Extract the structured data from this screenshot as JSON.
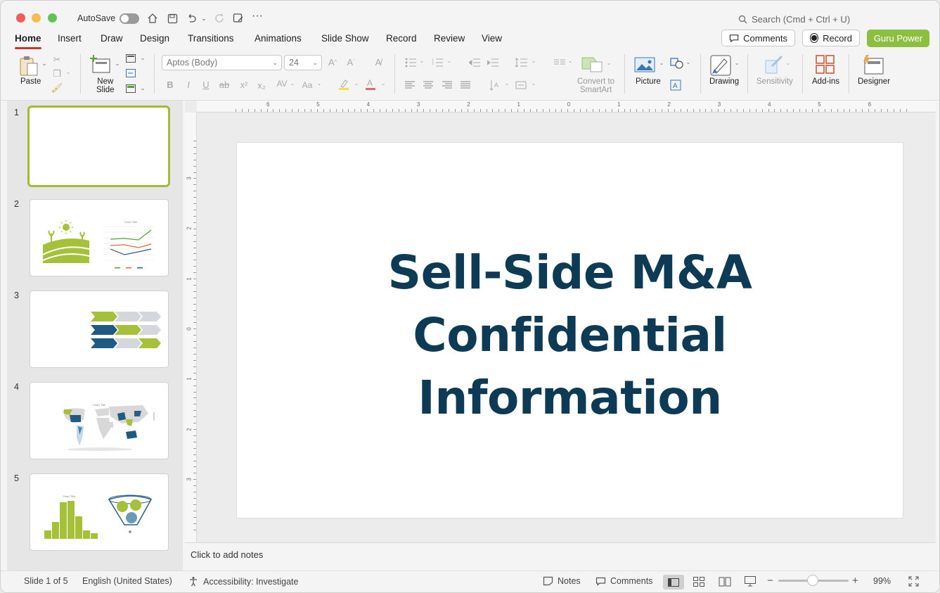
{
  "titlebar": {
    "autosave_label": "AutoSave",
    "search_placeholder": "Search (Cmd + Ctrl + U)"
  },
  "tabs": [
    "Home",
    "Insert",
    "Draw",
    "Design",
    "Transitions",
    "Animations",
    "Slide Show",
    "Record",
    "Review",
    "View"
  ],
  "top_buttons": {
    "comments": "Comments",
    "record": "Record",
    "guru": "Guru Power"
  },
  "ribbon": {
    "paste": "Paste",
    "new_slide_1": "New",
    "new_slide_2": "Slide",
    "font_name": "Aptos (Body)",
    "font_size": "24",
    "convert_1": "Convert to",
    "convert_2": "SmartArt",
    "picture": "Picture",
    "drawing": "Drawing",
    "sensitivity": "Sensitivity",
    "addins": "Add-ins",
    "designer": "Designer"
  },
  "thumb_numbers": [
    "1",
    "2",
    "3",
    "4",
    "5"
  ],
  "thumbs_text": {
    "chart_title": "Chart Title"
  },
  "ruler": {
    "h": [
      "6",
      "5",
      "4",
      "3",
      "2",
      "1",
      "0",
      "1",
      "2",
      "3",
      "4",
      "5",
      "6"
    ],
    "v": [
      "3",
      "2",
      "1",
      "0",
      "1",
      "2",
      "3"
    ]
  },
  "slide": {
    "title_lines": [
      "Sell-Side M&A",
      "Confidential",
      "Information"
    ]
  },
  "notes": {
    "placeholder": "Click to add notes"
  },
  "status": {
    "slide_of": "Slide 1 of 5",
    "language": "English (United States)",
    "accessibility": "Accessibility: Investigate",
    "notes": "Notes",
    "comments": "Comments",
    "zoom": "99%"
  },
  "colors": {
    "accent": "#8cbf3f",
    "title": "#0d3a54",
    "tab_underline": "#c0392b"
  }
}
